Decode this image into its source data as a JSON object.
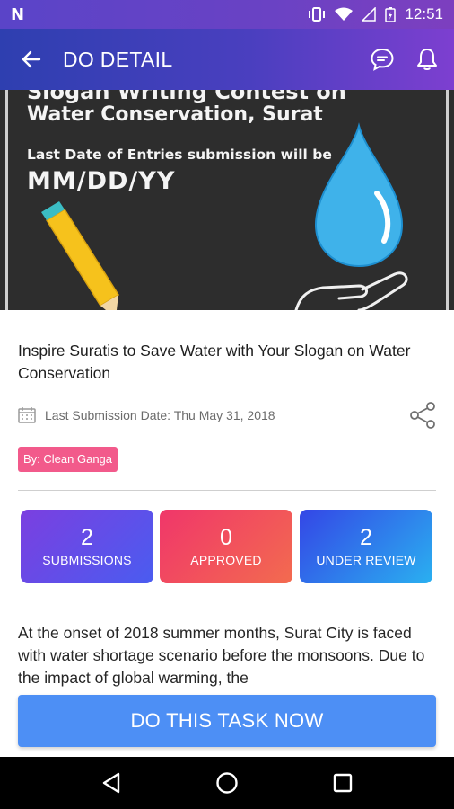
{
  "status_bar": {
    "left_icon": "n-notification-icon",
    "icons": [
      "vibrate-icon",
      "wifi-icon",
      "signal-icon",
      "battery-icon"
    ],
    "time": "12:51"
  },
  "app_bar": {
    "title": "DO DETAIL",
    "back_icon": "arrow-left-icon",
    "actions": [
      "chat-icon",
      "bell-icon"
    ]
  },
  "banner": {
    "line1": "Slogan Writing Contest on",
    "line2": "Water Conservation, Surat",
    "line3": "Last Date of Entries submission will be",
    "line4": "MM/DD/YY"
  },
  "task": {
    "title": "Inspire Suratis to Save Water with Your Slogan on Water Conservation",
    "last_submission": "Last Submission Date: Thu May 31, 2018",
    "by": "By: Clean Ganga"
  },
  "stats": [
    {
      "value": "2",
      "label": "SUBMISSIONS"
    },
    {
      "value": "0",
      "label": "APPROVED"
    },
    {
      "value": "2",
      "label": "UNDER REVIEW"
    }
  ],
  "description": "At the onset of 2018 summer months, Surat City is faced with water shortage scenario before the monsoons. Due to the impact of global warming, the",
  "cta": {
    "label": "DO THIS TASK NOW"
  },
  "colors": {
    "app_bar_start": "#2e3fb0",
    "app_bar_end": "#7d3fd0",
    "badge": "#f25a8b",
    "cta": "#4d8ff5"
  }
}
